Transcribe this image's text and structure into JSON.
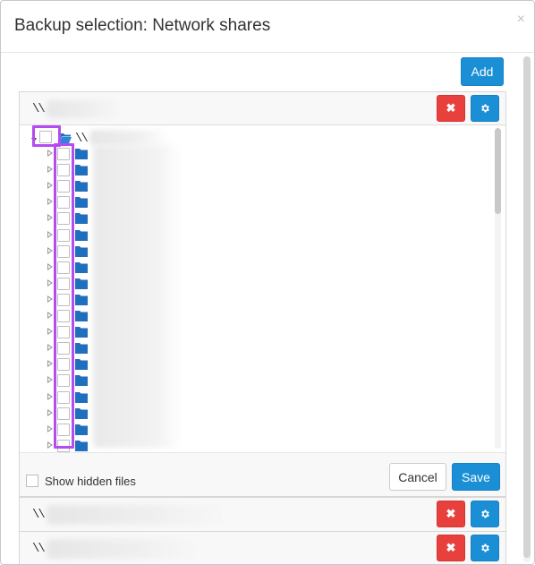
{
  "dialog": {
    "title": "Backup selection: Network shares",
    "close_label": "×",
    "add_label": "Add"
  },
  "shares": [
    {
      "path_prefix": "\\\\",
      "delete_label": "✖",
      "settings_icon": "gear-icon",
      "expanded": true
    },
    {
      "path_prefix": "\\\\",
      "delete_label": "✖",
      "settings_icon": "gear-icon",
      "expanded": false
    },
    {
      "path_prefix": "\\\\",
      "delete_label": "✖",
      "settings_icon": "gear-icon",
      "expanded": false
    }
  ],
  "tree": {
    "root_prefix": "\\\\",
    "child_folder_count": 19,
    "folder_icon": "folder-icon",
    "highlight_color": "#b44cf0"
  },
  "footer": {
    "show_hidden_label": "Show hidden files",
    "cancel_label": "Cancel",
    "save_label": "Save"
  },
  "colors": {
    "primary": "#1b8fd6",
    "danger": "#e8413d",
    "folder": "#1f6fbf"
  }
}
